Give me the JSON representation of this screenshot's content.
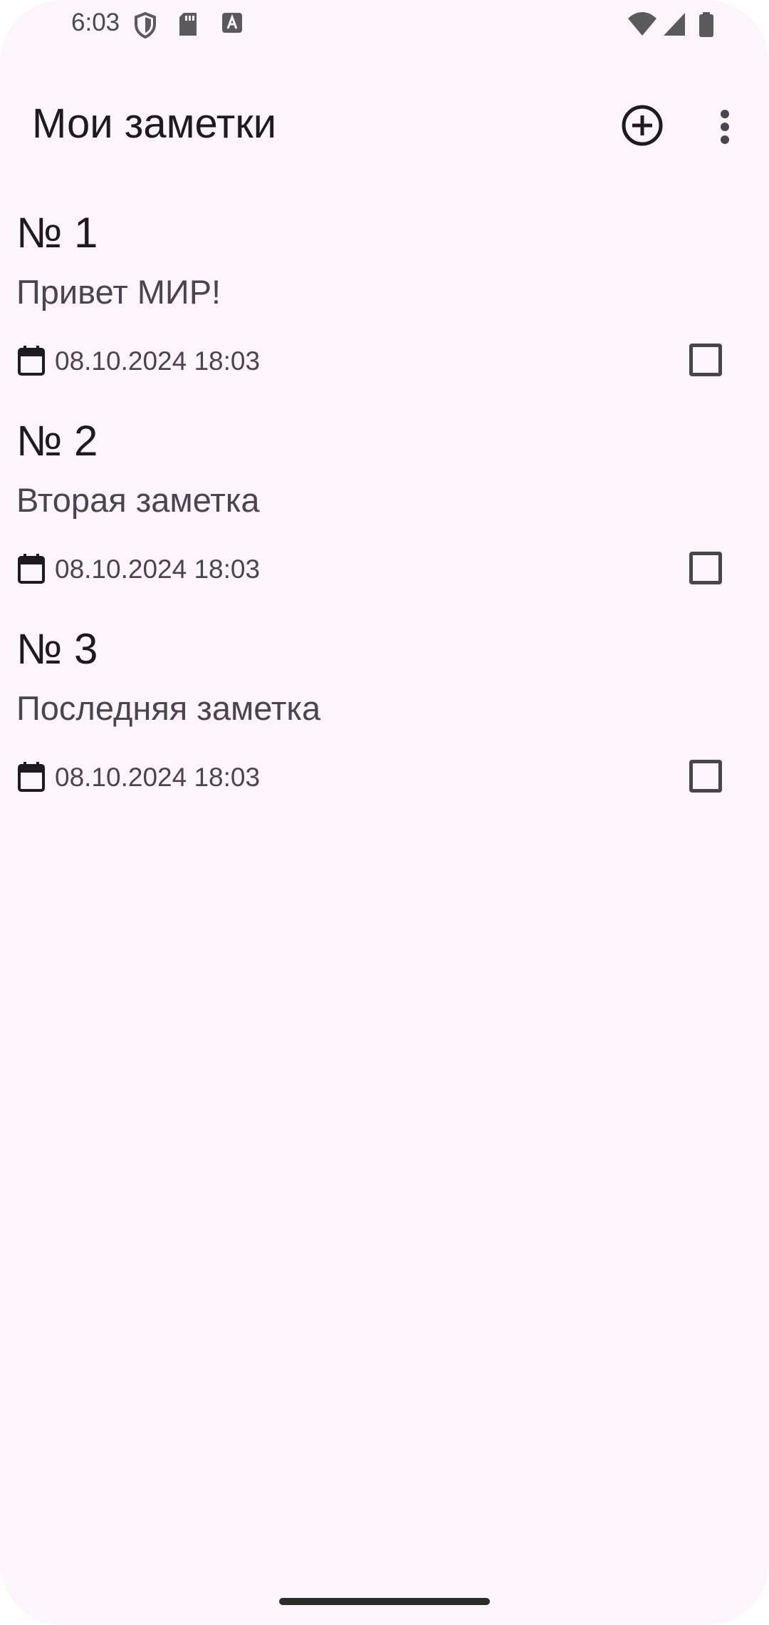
{
  "status_bar": {
    "time": "6:03",
    "left_icons": [
      "shield-icon",
      "sd-card-icon",
      "text-a-icon"
    ],
    "right_icons": [
      "wifi-icon",
      "signal-icon",
      "battery-icon"
    ]
  },
  "app_bar": {
    "title": "Мои заметки",
    "actions": [
      "add-circle-icon",
      "more-vertical-icon"
    ]
  },
  "notes": [
    {
      "title": "№ 1",
      "text": "Привет МИР!",
      "date": "08.10.2024 18:03",
      "checked": false
    },
    {
      "title": "№ 2",
      "text": "Вторая заметка",
      "date": "08.10.2024 18:03",
      "checked": false
    },
    {
      "title": "№ 3",
      "text": "Последняя заметка",
      "date": "08.10.2024 18:03",
      "checked": false
    }
  ]
}
